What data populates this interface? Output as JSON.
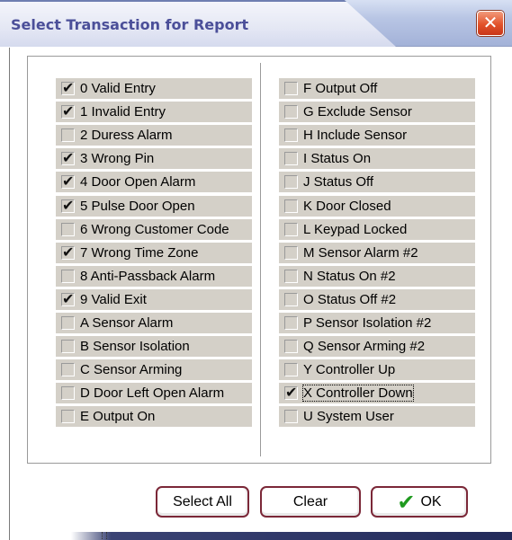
{
  "dialog": {
    "title": "Select Transaction for Report",
    "close_glyph": "✕"
  },
  "left_items": [
    {
      "label": "0 Valid Entry",
      "checked": true
    },
    {
      "label": "1 Invalid Entry",
      "checked": true
    },
    {
      "label": "2 Duress Alarm",
      "checked": false
    },
    {
      "label": "3 Wrong Pin",
      "checked": true
    },
    {
      "label": "4 Door Open Alarm",
      "checked": true
    },
    {
      "label": "5 Pulse Door Open",
      "checked": true
    },
    {
      "label": "6 Wrong Customer Code",
      "checked": false
    },
    {
      "label": "7 Wrong Time Zone",
      "checked": true
    },
    {
      "label": "8 Anti-Passback Alarm",
      "checked": false
    },
    {
      "label": "9 Valid Exit",
      "checked": true
    },
    {
      "label": "A Sensor Alarm",
      "checked": false
    },
    {
      "label": "B Sensor Isolation",
      "checked": false
    },
    {
      "label": "C Sensor Arming",
      "checked": false
    },
    {
      "label": "D Door Left Open Alarm",
      "checked": false
    },
    {
      "label": "E Output On",
      "checked": false
    }
  ],
  "right_items": [
    {
      "label": "F Output Off",
      "checked": false
    },
    {
      "label": "G Exclude Sensor",
      "checked": false
    },
    {
      "label": "H Include Sensor",
      "checked": false
    },
    {
      "label": "I Status On",
      "checked": false
    },
    {
      "label": "J Status Off",
      "checked": false
    },
    {
      "label": "K Door Closed",
      "checked": false
    },
    {
      "label": "L Keypad Locked",
      "checked": false
    },
    {
      "label": "M Sensor Alarm #2",
      "checked": false
    },
    {
      "label": "N Status On #2",
      "checked": false
    },
    {
      "label": "O Status Off #2",
      "checked": false
    },
    {
      "label": "P Sensor Isolation #2",
      "checked": false
    },
    {
      "label": "Q Sensor Arming #2",
      "checked": false
    },
    {
      "label": "Y Controller Up",
      "checked": false
    },
    {
      "label": "X Controller Down",
      "checked": true,
      "focused": true
    },
    {
      "label": "U System User",
      "checked": false
    }
  ],
  "buttons": {
    "select_all": "Select All",
    "clear": "Clear",
    "ok": "OK"
  },
  "icons": {
    "check_glyph": "✔",
    "ok_icon": "check-icon"
  }
}
